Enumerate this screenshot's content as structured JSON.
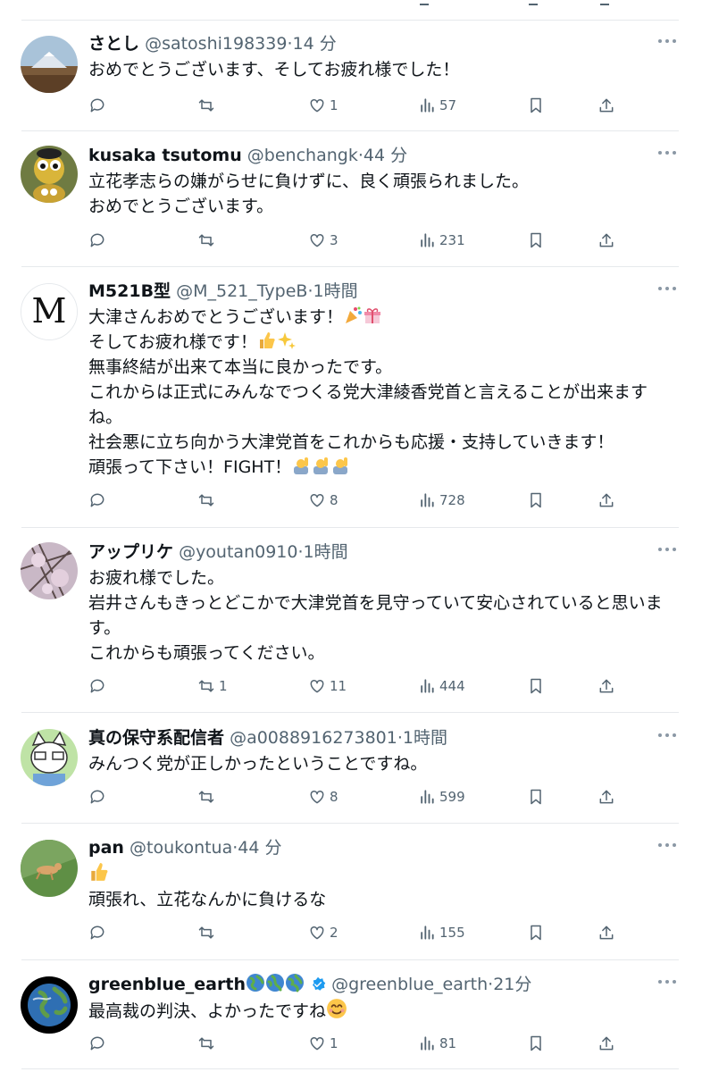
{
  "tweets": [
    {
      "name": "さとし",
      "handle": "@satoshi198339",
      "time": "14 分",
      "lines": [
        "おめでとうございます、そしてお疲れ様でした！"
      ],
      "reply": "",
      "retweet": "",
      "like": "1",
      "views": "57"
    },
    {
      "name": "kusaka tsutomu",
      "handle": "@benchangk",
      "time": "44 分",
      "lines": [
        "立花孝志らの嫌がらせに負けずに、良く頑張られました。",
        "おめでとうございます。"
      ],
      "reply": "",
      "retweet": "",
      "like": "3",
      "views": "231"
    },
    {
      "name": "M521B型",
      "handle": "@M_521_TypeB",
      "time": "1時間",
      "lines": [
        "大津さんおめでとうございます！",
        "そしてお疲れ様です！",
        "無事終結が出来て本当に良かったです。",
        "これからは正式にみんなでつくる党大津綾香党首と言えることが出来ます",
        "ね。",
        "社会悪に立ち向かう大津党首をこれからも応援・支持していきます！",
        "頑張って下さい！FIGHT！"
      ],
      "reply": "",
      "retweet": "",
      "like": "8",
      "views": "728"
    },
    {
      "name": "アップリケ",
      "handle": "@youtan0910",
      "time": "1時間",
      "lines": [
        "お疲れ様でした。",
        "岩井さんもきっとどこかで大津党首を見守っていて安心されていると思いま",
        "す。",
        "これからも頑張ってください。"
      ],
      "reply": "",
      "retweet": "1",
      "like": "11",
      "views": "444"
    },
    {
      "name": "真の保守系配信者",
      "handle": "@a0088916273801",
      "time": "1時間",
      "lines": [
        "みんつく党が正しかったということですね。"
      ],
      "reply": "",
      "retweet": "",
      "like": "8",
      "views": "599"
    },
    {
      "name": "pan",
      "handle": "@toukontua",
      "time": "44 分",
      "lines": [
        "",
        "頑張れ、立花なんかに負けるな"
      ],
      "reply": "",
      "retweet": "",
      "like": "2",
      "views": "155"
    },
    {
      "name": "greenblue_earth",
      "handle": "@greenblue_earth",
      "time": "21分",
      "lines": [
        "最高裁の判決、よかったですね"
      ],
      "reply": "",
      "retweet": "",
      "like": "1",
      "views": "81"
    }
  ],
  "sep": "·",
  "avatar_3_letter": "M",
  "icons": {
    "reply": "reply-icon",
    "retweet": "retweet-icon",
    "like": "heart-icon",
    "views": "views-icon",
    "bookmark": "bookmark-icon",
    "share": "share-icon",
    "more": "more-icon"
  },
  "colors": {
    "text": "#0f1419",
    "muted": "#536471",
    "divider": "#e6e9ec",
    "verified": "#1d9bf0"
  }
}
